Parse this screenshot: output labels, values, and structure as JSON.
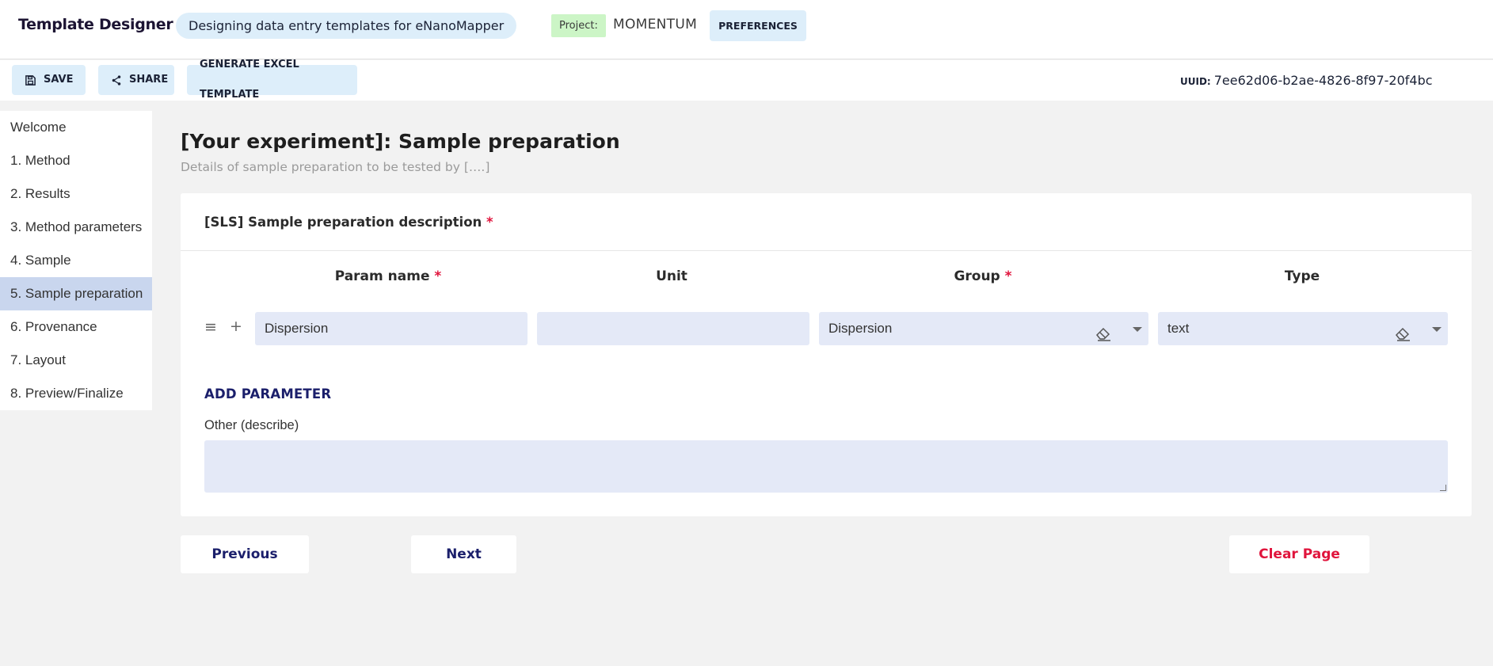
{
  "header": {
    "app_title": "Template Designer",
    "subtitle": "Designing data entry templates for eNanoMapper",
    "project_label": "Project:",
    "project_name": "MOMENTUM",
    "preferences_label": "PREFERENCES"
  },
  "toolbar": {
    "save_label": "SAVE",
    "share_label": "SHARE",
    "generate_label": "GENERATE EXCEL TEMPLATE",
    "uuid_label": "UUID:",
    "uuid_value": "7ee62d06-b2ae-4826-8f97-20f4bc"
  },
  "sidebar": {
    "items": [
      {
        "label": "Welcome"
      },
      {
        "label": "1. Method"
      },
      {
        "label": "2. Results"
      },
      {
        "label": "3. Method parameters"
      },
      {
        "label": "4. Sample"
      },
      {
        "label": "5. Sample preparation",
        "active": true
      },
      {
        "label": "6. Provenance"
      },
      {
        "label": "7. Layout"
      },
      {
        "label": "8. Preview/Finalize"
      }
    ]
  },
  "main": {
    "title": "[Your experiment]: Sample preparation",
    "description": "Details of sample preparation to be tested by  [….]",
    "card_title": "[SLS] Sample preparation description",
    "required_mark": "*",
    "columns": {
      "param_name": "Param name",
      "unit": "Unit",
      "group": "Group",
      "type": "Type"
    },
    "row": {
      "param_name": "Dispersion",
      "unit": "",
      "group": "Dispersion",
      "type": "text"
    },
    "add_parameter_label": "ADD PARAMETER",
    "other_label": "Other (describe)",
    "other_value": ""
  },
  "footer": {
    "previous_label": "Previous",
    "next_label": "Next",
    "clear_label": "Clear Page"
  },
  "colors": {
    "accent_light": "#ddeefa",
    "project_tag": "#ccf5c6",
    "field_bg": "#e4e9f7",
    "nav_active": "#c9d6ee",
    "primary_text": "#1b1f6b",
    "danger": "#e0143c"
  },
  "icons": [
    "save-icon",
    "share-icon",
    "drag-handle-icon",
    "add-icon",
    "eraser-icon",
    "chevron-down-icon"
  ]
}
